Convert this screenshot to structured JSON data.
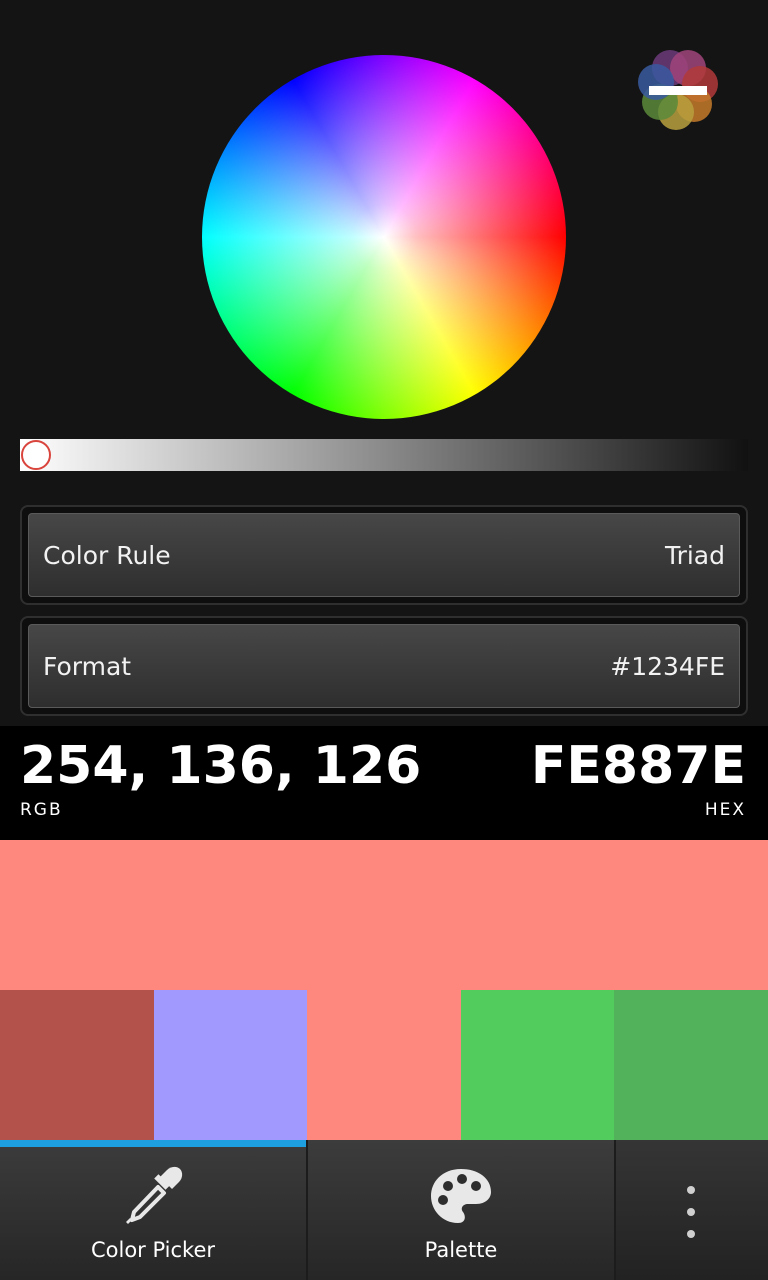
{
  "settings": {
    "color_rule": {
      "label": "Color Rule",
      "value": "Triad"
    },
    "format": {
      "label": "Format",
      "value": "#1234FE"
    }
  },
  "readout": {
    "rgb_value": "254, 136, 126",
    "rgb_caption": "RGB",
    "hex_value": "FE887E",
    "hex_caption": "HEX"
  },
  "brightness_level": 0,
  "swatches": {
    "main": "#FE887E",
    "row": [
      "#B2524A",
      "#A199FE",
      "#FE887E",
      "#53CC5E",
      "#52B25C"
    ]
  },
  "bottom_bar": {
    "tabs": [
      {
        "label": "Color Picker",
        "icon": "eyedropper-icon",
        "selected": true
      },
      {
        "label": "Palette",
        "icon": "palette-icon",
        "selected": false
      }
    ],
    "overflow_icon": "overflow-menu-icon"
  },
  "colors": {
    "accent": "#1E9FE0",
    "background": "#141414",
    "handle_border": "#D9443C"
  },
  "logo_icon": "palette-logo-icon"
}
